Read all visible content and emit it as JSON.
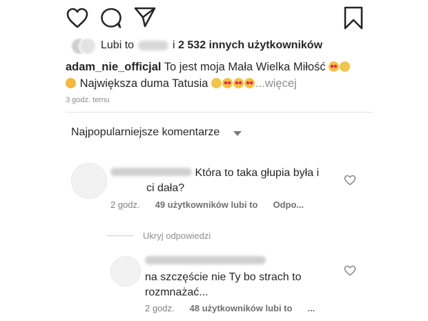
{
  "actions": {
    "like_icon": "heart-icon",
    "comment_icon": "comment-icon",
    "share_icon": "send-icon",
    "save_icon": "bookmark-icon"
  },
  "likes": {
    "prefix": "Lubi to",
    "connector": "i",
    "others": "2 532 innych użytkowników"
  },
  "caption": {
    "username": "adam_nie_officjal",
    "text_1": "To jest moja Mała Wielka Miłość",
    "text_2": "Największa duma Tatusia",
    "more": "...więcej"
  },
  "timestamp": "3 godz. temu",
  "sort": {
    "label": "Najpopularniejsze komentarze"
  },
  "comments": [
    {
      "text_line1": "Która to taka głupia była i",
      "text_line2": "ci dała?",
      "time": "2 godz.",
      "likes": "49 użytkowników lubi to",
      "reply": "Odpo..."
    }
  ],
  "hide_replies": "Ukryj odpowiedzi",
  "replies": [
    {
      "text_line1": "na szczęście nie Ty bo strach to",
      "text_line2": "rozmnażać...",
      "time": "2 godz.",
      "likes": "48 użytkowników lubi to",
      "reply": "..."
    }
  ],
  "colors": {
    "text": "#262626",
    "muted": "#8e8e8e",
    "divider": "#e2e2e2"
  }
}
